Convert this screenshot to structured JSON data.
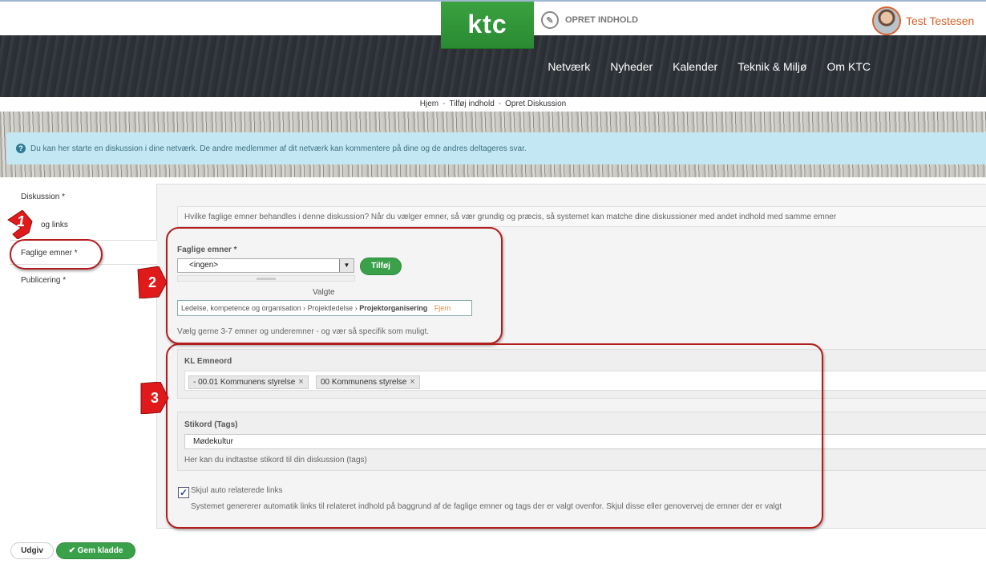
{
  "header": {
    "logo": "ktc",
    "create_label": "OPRET INDHOLD",
    "user_name": "Test Testesen",
    "nav": [
      "Netværk",
      "Nyheder",
      "Kalender",
      "Teknik & Miljø",
      "Om KTC"
    ]
  },
  "breadcrumb": [
    "Hjem",
    "Tilføj indhold",
    "Opret Diskussion"
  ],
  "info_text": "Du kan her starte en diskussion i dine netværk. De andre medlemmer af dit netværk kan kommentere på dine og de andres deltageres svar.",
  "sidebar": {
    "items": [
      "Diskussion *",
      "Relaterede og links",
      "Faglige emner *",
      "Publicering *"
    ],
    "visible_item_1": "og links",
    "active_index": 2
  },
  "main": {
    "question": "Hvilke faglige emner behandles i denne diskussion? Når du vælger emner, så vær grundig og præcis, så systemet kan matche dine diskussioner med andet indhold med samme emner",
    "faglige_label": "Faglige emner *",
    "select_value": "<ingen>",
    "add_button": "Tilføj",
    "valgte_label": "Valgte",
    "chosen_path": [
      "Ledelse, kompetence og organisation",
      "Projektledelse",
      "Projektorganisering"
    ],
    "chosen_sep": "›",
    "remove_label": "Fjern",
    "faglige_hint": "Vælg gerne 3-7 emner og underemner - og vær så specifik som muligt.",
    "kl_label": "KL Emneord",
    "kl_tags": [
      "- 00.01 Kommunens styrelse",
      "00 Kommunens styrelse"
    ],
    "tag_remove": "×",
    "stikord_label": "Stikord (Tags)",
    "stikord_value": "Mødekultur",
    "stikord_hint": "Her kan du indtastse stikord til din diskussion (tags)",
    "checkbox_label": "Skjul auto relaterede links",
    "checkbox_checked": true,
    "checkbox_hint": "Systemet genererer automatik links til relateret indhold på baggrund af de faglige emner og tags der er valgt ovenfor. Skjul disse eller genovervej de emner der er valgt"
  },
  "annotations": [
    "1",
    "2",
    "3"
  ],
  "footer": {
    "publish": "Udgiv",
    "save_draft": "Gem kladde"
  },
  "colors": {
    "brand_green": "#3aa23f",
    "annotation_red": "#b51d1d",
    "user_orange": "#d9622b",
    "info_bg": "#c4e8f3"
  }
}
